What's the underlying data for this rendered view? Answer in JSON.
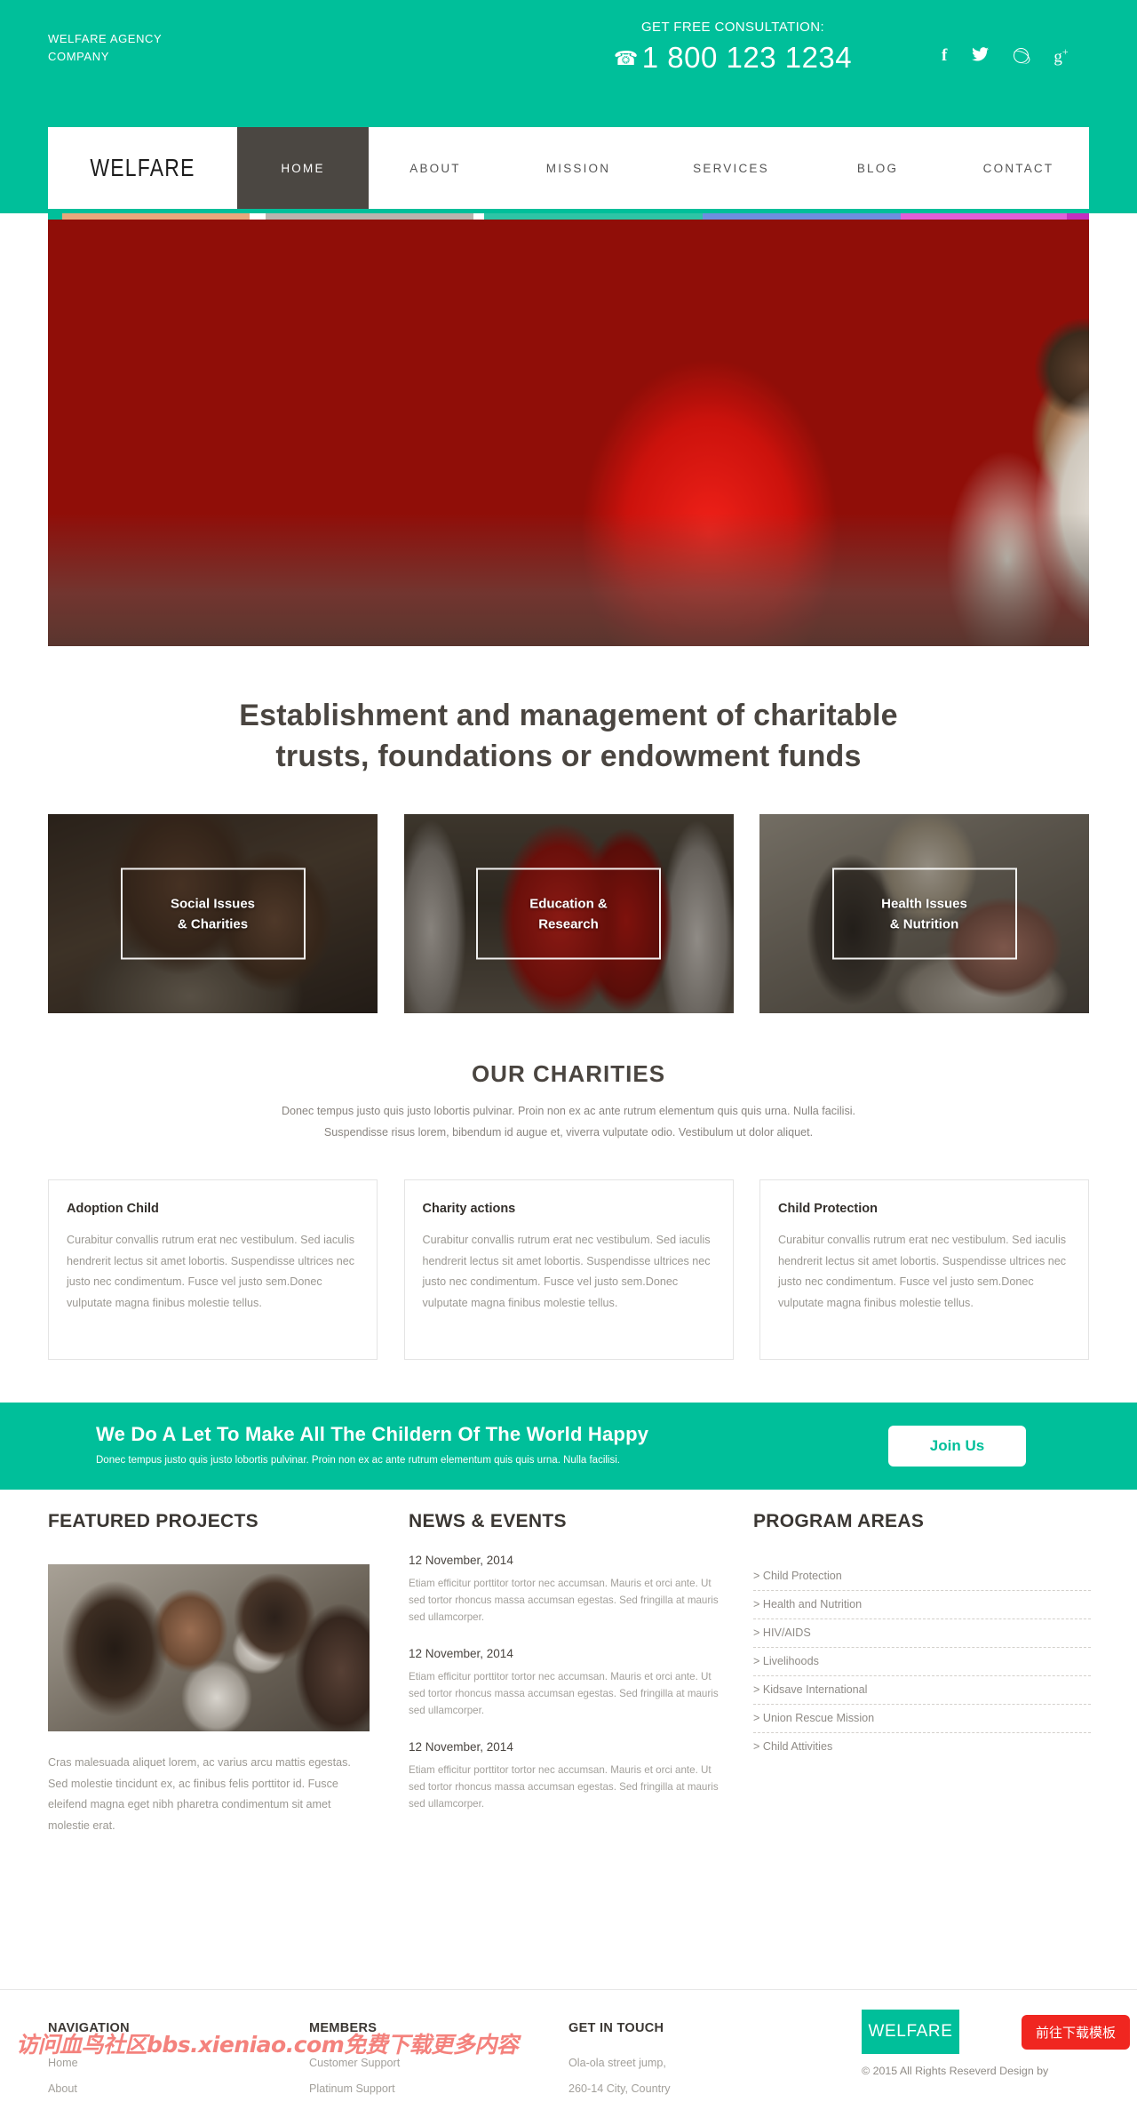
{
  "colors": {
    "brand_green": "#00bf9a",
    "nav_active": "#4b4742",
    "cta_red": "#f02620",
    "text_dark": "#3b3733",
    "text_muted": "#9b9892"
  },
  "topbar": {
    "agency_line1": "WELFARE AGENCY",
    "agency_line2": "COMPANY",
    "consultation_label": "GET FREE CONSULTATION:",
    "phone_icon": "phone-icon",
    "phone": "1 800 123 1234",
    "socials": [
      {
        "name": "facebook-icon",
        "glyph": "f"
      },
      {
        "name": "twitter-icon",
        "glyph": "✐"
      },
      {
        "name": "dribbble-icon",
        "glyph": ""
      },
      {
        "name": "googleplus-icon",
        "glyph": "g+"
      }
    ]
  },
  "nav": {
    "logo": "WELFARE",
    "items": [
      {
        "label": "HOME",
        "active": true
      },
      {
        "label": "ABOUT",
        "active": false
      },
      {
        "label": "MISSION",
        "active": false
      },
      {
        "label": "SERVICES",
        "active": false
      },
      {
        "label": "BLOG",
        "active": false
      },
      {
        "label": "CONTACT",
        "active": false
      }
    ]
  },
  "hero": {
    "strip_colors": [
      "#00bf9a",
      "#e8a87c",
      "#ffffff",
      "#b9b4ae",
      "#ffffff",
      "#2ec4a6",
      "#6d8fe0",
      "#e05fd8",
      "#c030c0"
    ],
    "alt": "children in red and white school uniforms"
  },
  "headline": {
    "line1": "Establishment and management of charitable",
    "line2": "trusts, foundations or endowment funds"
  },
  "features": [
    {
      "line1": "Social Issues",
      "line2": "& Charities"
    },
    {
      "line1": "Education &",
      "line2": "Research"
    },
    {
      "line1": "Health Issues",
      "line2": "& Nutrition"
    }
  ],
  "charities": {
    "title": "OUR CHARITIES",
    "subtitle_line1": "Donec tempus justo quis justo lobortis pulvinar. Proin non ex ac ante rutrum elementum quis quis urna. Nulla facilisi.",
    "subtitle_line2": "Suspendisse risus lorem, bibendum id augue et, viverra vulputate odio. Vestibulum ut dolor aliquet.",
    "body": "Curabitur convallis rutrum erat nec vestibulum. Sed iaculis hendrerit lectus sit amet lobortis. Suspendisse ultrices nec justo nec condimentum. Fusce vel justo sem.Donec vulputate magna finibus molestie tellus.",
    "boxes": [
      {
        "title": "Adoption Child"
      },
      {
        "title": "Charity actions"
      },
      {
        "title": "Child Protection"
      }
    ]
  },
  "cta": {
    "heading": "We Do A Let To Make All The Childern Of The World Happy",
    "sub": "Donec tempus justo quis justo lobortis pulvinar. Proin non ex ac ante rutrum elementum quis quis urna. Nulla facilisi.",
    "button": "Join Us"
  },
  "featured_projects": {
    "heading": "FEATURED PROJECTS",
    "image_alt": "children gathered around a table with a lamp",
    "text": "Cras malesuada aliquet lorem, ac varius arcu mattis egestas. Sed molestie tincidunt ex, ac finibus felis porttitor id. Fusce eleifend magna eget nibh pharetra condimentum sit amet molestie erat."
  },
  "news": {
    "heading": "NEWS & EVENTS",
    "items": [
      {
        "date": "12 November, 2014",
        "body": "Etiam efficitur porttitor tortor nec accumsan. Mauris et orci ante. Ut sed tortor rhoncus massa accumsan egestas. Sed fringilla at mauris sed ullamcorper."
      },
      {
        "date": "12 November, 2014",
        "body": "Etiam efficitur porttitor tortor nec accumsan. Mauris et orci ante. Ut sed tortor rhoncus massa accumsan egestas. Sed fringilla at mauris sed ullamcorper."
      },
      {
        "date": "12 November, 2014",
        "body": "Etiam efficitur porttitor tortor nec accumsan. Mauris et orci ante. Ut sed tortor rhoncus massa accumsan egestas. Sed fringilla at mauris sed ullamcorper."
      }
    ]
  },
  "program_areas": {
    "heading": "PROGRAM AREAS",
    "items": [
      "> Child Protection",
      "> Health and Nutrition",
      "> HIV/AIDS",
      "> Livelihoods",
      "> Kidsave International",
      "> Union Rescue Mission",
      "> Child Attivities"
    ]
  },
  "footer": {
    "navigation": {
      "heading": "NAVIGATION",
      "links": [
        "Home",
        "About"
      ]
    },
    "members": {
      "heading": "MEMBERS",
      "links": [
        "Customer Support",
        "Platinum Support"
      ]
    },
    "get_in_touch": {
      "heading": "GET IN TOUCH",
      "lines": [
        "Ola-ola street jump,",
        "260-14 City, Country"
      ]
    },
    "logo": "WELFARE",
    "download_button": "前往下载模板",
    "copyright": "© 2015 All Rights Reseverd Design by"
  },
  "watermark": "访问血鸟社区bbs.xieniao.com免费下载更多内容"
}
